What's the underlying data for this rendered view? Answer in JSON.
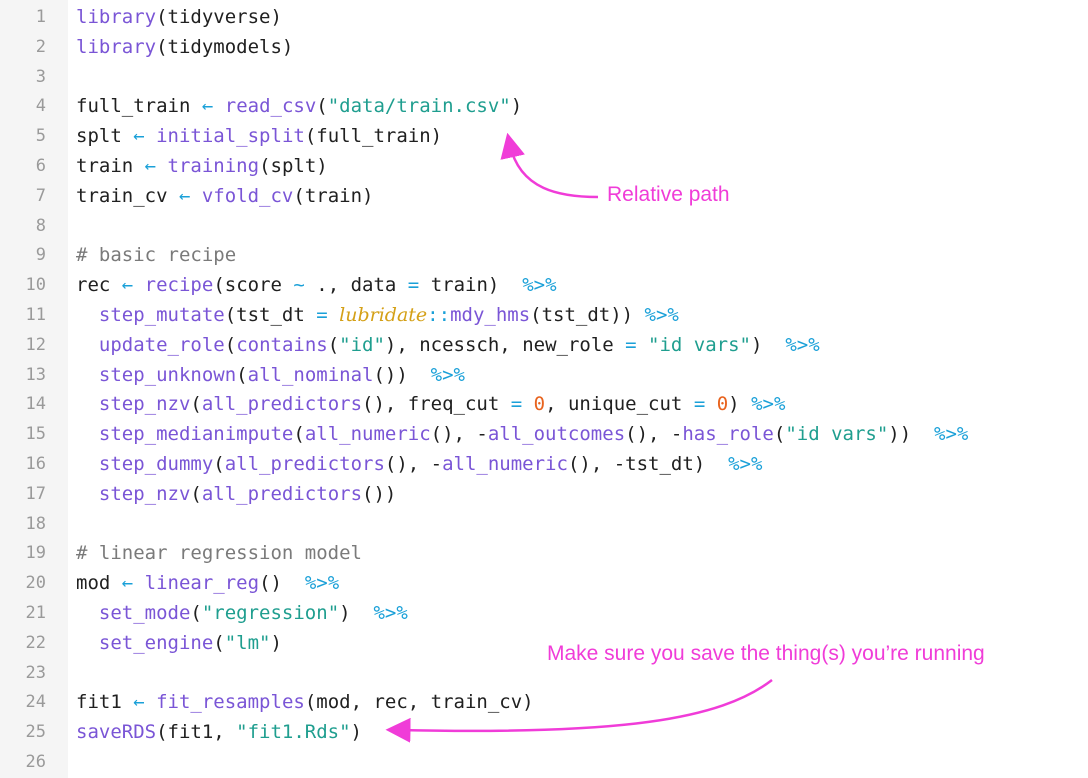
{
  "colors": {
    "function": "#7a55d6",
    "string": "#1f9e8f",
    "keyword": "#1aa0d8",
    "number": "#e8631e",
    "comment": "#7a7a7a",
    "namespace": "#d4a017",
    "default": "#202020",
    "annotation": "#f03cd8"
  },
  "lines": [
    {
      "n": "1",
      "t": [
        {
          "s": "library",
          "c": "function"
        },
        {
          "s": "(tidyverse)",
          "c": "default"
        }
      ]
    },
    {
      "n": "2",
      "t": [
        {
          "s": "library",
          "c": "function"
        },
        {
          "s": "(tidymodels)",
          "c": "default"
        }
      ]
    },
    {
      "n": "3",
      "t": []
    },
    {
      "n": "4",
      "t": [
        {
          "s": "full_train ",
          "c": "default"
        },
        {
          "s": "←",
          "c": "keyword"
        },
        {
          "s": " ",
          "c": "default"
        },
        {
          "s": "read_csv",
          "c": "function"
        },
        {
          "s": "(",
          "c": "default"
        },
        {
          "s": "\"data/train.csv\"",
          "c": "string"
        },
        {
          "s": ")",
          "c": "default"
        }
      ]
    },
    {
      "n": "5",
      "t": [
        {
          "s": "splt ",
          "c": "default"
        },
        {
          "s": "←",
          "c": "keyword"
        },
        {
          "s": " ",
          "c": "default"
        },
        {
          "s": "initial_split",
          "c": "function"
        },
        {
          "s": "(full_train)",
          "c": "default"
        }
      ]
    },
    {
      "n": "6",
      "t": [
        {
          "s": "train ",
          "c": "default"
        },
        {
          "s": "←",
          "c": "keyword"
        },
        {
          "s": " ",
          "c": "default"
        },
        {
          "s": "training",
          "c": "function"
        },
        {
          "s": "(splt)",
          "c": "default"
        }
      ]
    },
    {
      "n": "7",
      "t": [
        {
          "s": "train_cv ",
          "c": "default"
        },
        {
          "s": "←",
          "c": "keyword"
        },
        {
          "s": " ",
          "c": "default"
        },
        {
          "s": "vfold_cv",
          "c": "function"
        },
        {
          "s": "(train)",
          "c": "default"
        }
      ]
    },
    {
      "n": "8",
      "t": []
    },
    {
      "n": "9",
      "t": [
        {
          "s": "# basic recipe",
          "c": "comment"
        }
      ]
    },
    {
      "n": "10",
      "t": [
        {
          "s": "rec ",
          "c": "default"
        },
        {
          "s": "←",
          "c": "keyword"
        },
        {
          "s": " ",
          "c": "default"
        },
        {
          "s": "recipe",
          "c": "function"
        },
        {
          "s": "(score ",
          "c": "default"
        },
        {
          "s": "~",
          "c": "keyword"
        },
        {
          "s": " ., data ",
          "c": "default"
        },
        {
          "s": "=",
          "c": "keyword"
        },
        {
          "s": " train)  ",
          "c": "default"
        },
        {
          "s": "%>%",
          "c": "keyword"
        }
      ]
    },
    {
      "n": "11",
      "t": [
        {
          "s": "  ",
          "c": "default"
        },
        {
          "s": "step_mutate",
          "c": "function"
        },
        {
          "s": "(tst_dt ",
          "c": "default"
        },
        {
          "s": "=",
          "c": "keyword"
        },
        {
          "s": " ",
          "c": "default"
        },
        {
          "s": "lubridate",
          "c": "namespace"
        },
        {
          "s": "::",
          "c": "keyword"
        },
        {
          "s": "mdy_hms",
          "c": "function"
        },
        {
          "s": "(tst_dt)) ",
          "c": "default"
        },
        {
          "s": "%>%",
          "c": "keyword"
        }
      ]
    },
    {
      "n": "12",
      "t": [
        {
          "s": "  ",
          "c": "default"
        },
        {
          "s": "update_role",
          "c": "function"
        },
        {
          "s": "(",
          "c": "default"
        },
        {
          "s": "contains",
          "c": "function"
        },
        {
          "s": "(",
          "c": "default"
        },
        {
          "s": "\"id\"",
          "c": "string"
        },
        {
          "s": "), ncessch, new_role ",
          "c": "default"
        },
        {
          "s": "=",
          "c": "keyword"
        },
        {
          "s": " ",
          "c": "default"
        },
        {
          "s": "\"id vars\"",
          "c": "string"
        },
        {
          "s": ")  ",
          "c": "default"
        },
        {
          "s": "%>%",
          "c": "keyword"
        }
      ]
    },
    {
      "n": "13",
      "t": [
        {
          "s": "  ",
          "c": "default"
        },
        {
          "s": "step_unknown",
          "c": "function"
        },
        {
          "s": "(",
          "c": "default"
        },
        {
          "s": "all_nominal",
          "c": "function"
        },
        {
          "s": "())  ",
          "c": "default"
        },
        {
          "s": "%>%",
          "c": "keyword"
        }
      ]
    },
    {
      "n": "14",
      "t": [
        {
          "s": "  ",
          "c": "default"
        },
        {
          "s": "step_nzv",
          "c": "function"
        },
        {
          "s": "(",
          "c": "default"
        },
        {
          "s": "all_predictors",
          "c": "function"
        },
        {
          "s": "(), freq_cut ",
          "c": "default"
        },
        {
          "s": "=",
          "c": "keyword"
        },
        {
          "s": " ",
          "c": "default"
        },
        {
          "s": "0",
          "c": "number"
        },
        {
          "s": ", unique_cut ",
          "c": "default"
        },
        {
          "s": "=",
          "c": "keyword"
        },
        {
          "s": " ",
          "c": "default"
        },
        {
          "s": "0",
          "c": "number"
        },
        {
          "s": ") ",
          "c": "default"
        },
        {
          "s": "%>%",
          "c": "keyword"
        }
      ]
    },
    {
      "n": "15",
      "t": [
        {
          "s": "  ",
          "c": "default"
        },
        {
          "s": "step_medianimpute",
          "c": "function"
        },
        {
          "s": "(",
          "c": "default"
        },
        {
          "s": "all_numeric",
          "c": "function"
        },
        {
          "s": "(), -",
          "c": "default"
        },
        {
          "s": "all_outcomes",
          "c": "function"
        },
        {
          "s": "(), -",
          "c": "default"
        },
        {
          "s": "has_role",
          "c": "function"
        },
        {
          "s": "(",
          "c": "default"
        },
        {
          "s": "\"id vars\"",
          "c": "string"
        },
        {
          "s": "))  ",
          "c": "default"
        },
        {
          "s": "%>%",
          "c": "keyword"
        }
      ]
    },
    {
      "n": "16",
      "t": [
        {
          "s": "  ",
          "c": "default"
        },
        {
          "s": "step_dummy",
          "c": "function"
        },
        {
          "s": "(",
          "c": "default"
        },
        {
          "s": "all_predictors",
          "c": "function"
        },
        {
          "s": "(), -",
          "c": "default"
        },
        {
          "s": "all_numeric",
          "c": "function"
        },
        {
          "s": "(), -tst_dt)  ",
          "c": "default"
        },
        {
          "s": "%>%",
          "c": "keyword"
        }
      ]
    },
    {
      "n": "17",
      "t": [
        {
          "s": "  ",
          "c": "default"
        },
        {
          "s": "step_nzv",
          "c": "function"
        },
        {
          "s": "(",
          "c": "default"
        },
        {
          "s": "all_predictors",
          "c": "function"
        },
        {
          "s": "())",
          "c": "default"
        }
      ]
    },
    {
      "n": "18",
      "t": []
    },
    {
      "n": "19",
      "t": [
        {
          "s": "# linear regression model",
          "c": "comment"
        }
      ]
    },
    {
      "n": "20",
      "t": [
        {
          "s": "mod ",
          "c": "default"
        },
        {
          "s": "←",
          "c": "keyword"
        },
        {
          "s": " ",
          "c": "default"
        },
        {
          "s": "linear_reg",
          "c": "function"
        },
        {
          "s": "()  ",
          "c": "default"
        },
        {
          "s": "%>%",
          "c": "keyword"
        }
      ]
    },
    {
      "n": "21",
      "t": [
        {
          "s": "  ",
          "c": "default"
        },
        {
          "s": "set_mode",
          "c": "function"
        },
        {
          "s": "(",
          "c": "default"
        },
        {
          "s": "\"regression\"",
          "c": "string"
        },
        {
          "s": ")  ",
          "c": "default"
        },
        {
          "s": "%>%",
          "c": "keyword"
        }
      ]
    },
    {
      "n": "22",
      "t": [
        {
          "s": "  ",
          "c": "default"
        },
        {
          "s": "set_engine",
          "c": "function"
        },
        {
          "s": "(",
          "c": "default"
        },
        {
          "s": "\"lm\"",
          "c": "string"
        },
        {
          "s": ")",
          "c": "default"
        }
      ]
    },
    {
      "n": "23",
      "t": []
    },
    {
      "n": "24",
      "t": [
        {
          "s": "fit1 ",
          "c": "default"
        },
        {
          "s": "←",
          "c": "keyword"
        },
        {
          "s": " ",
          "c": "default"
        },
        {
          "s": "fit_resamples",
          "c": "function"
        },
        {
          "s": "(mod, rec, train_cv)",
          "c": "default"
        }
      ]
    },
    {
      "n": "25",
      "t": [
        {
          "s": "saveRDS",
          "c": "function"
        },
        {
          "s": "(fit1, ",
          "c": "default"
        },
        {
          "s": "\"fit1.Rds\"",
          "c": "string"
        },
        {
          "s": ")",
          "c": "default"
        }
      ]
    },
    {
      "n": "26",
      "t": []
    }
  ],
  "annotations": {
    "relative_path": "Relative path",
    "save_note": "Make sure you save the thing(s) you’re running"
  }
}
